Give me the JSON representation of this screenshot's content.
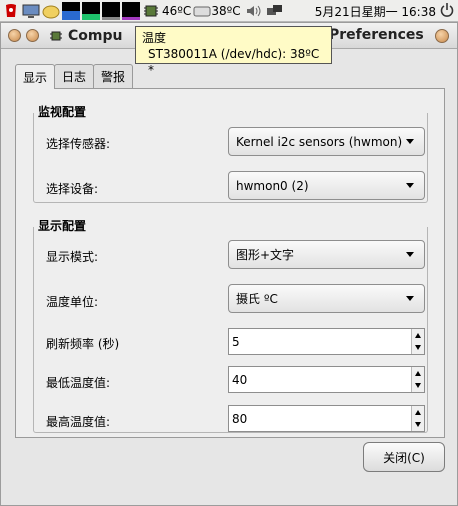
{
  "panel": {
    "cpu_temp": "46ºC",
    "disk_temp": "38ºC",
    "clock": "5月21日星期一 16:38"
  },
  "window": {
    "title_left": "Compu",
    "title_right": "Preferences"
  },
  "tooltip": {
    "line1": "温度",
    "line2": "ST380011A (/dev/hdc): 38ºC *"
  },
  "tabs": [
    {
      "label": "显示",
      "active": true
    },
    {
      "label": "日志",
      "active": false
    },
    {
      "label": "警报",
      "active": false
    }
  ],
  "monitor_section": {
    "heading": "监视配置",
    "sensor_label": "选择传感器:",
    "sensor_value": "Kernel i2c sensors (hwmon)",
    "device_label": "选择设备:",
    "device_value": "hwmon0 (2)"
  },
  "display_section": {
    "heading": "显示配置",
    "mode_label": "显示模式:",
    "mode_value": "图形+文字",
    "unit_label": "温度单位:",
    "unit_value": "摄氏 ºC",
    "refresh_label": "刷新频率 (秒)",
    "refresh_value": "5",
    "min_label": "最低温度值:",
    "min_value": "40",
    "max_label": "最高温度值:",
    "max_value": "80"
  },
  "buttons": {
    "close": "关闭(C)"
  },
  "colors": {
    "tooltip_bg": "#fffbc6",
    "window_bg": "#e6e6e6"
  }
}
